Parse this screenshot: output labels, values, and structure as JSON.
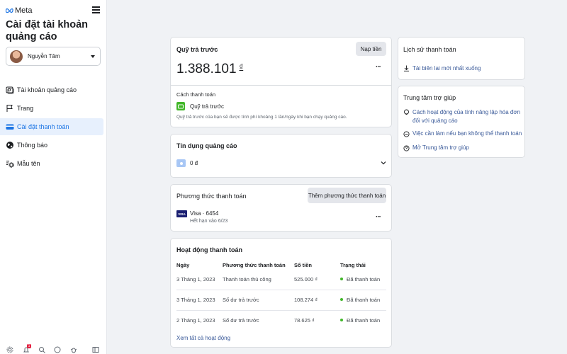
{
  "brand": {
    "name": "Meta"
  },
  "sidebar": {
    "title": "Cài đặt tài khoản quảng cáo",
    "account_name": "Nguyễn Tâm",
    "items": [
      {
        "label": "Tài khoản quảng cáo",
        "icon": "ad-accounts-icon"
      },
      {
        "label": "Trang",
        "icon": "flag-icon"
      },
      {
        "label": "Cài đặt thanh toán",
        "icon": "credit-card-icon",
        "active": true
      },
      {
        "label": "Thông báo",
        "icon": "globe-icon"
      },
      {
        "label": "Mẫu tên",
        "icon": "gear-list-icon"
      }
    ],
    "bottom": {
      "notification_count": "1"
    }
  },
  "prepaid": {
    "title": "Quỹ trả trước",
    "add_funds_label": "Nạp tiền",
    "balance": "1.388.101",
    "currency": "₫",
    "method_heading": "Cách thanh toán",
    "method_name": "Quỹ trả trước",
    "method_desc": "Quỹ trả trước của bạn sẽ được tính phí khoảng 1 lần/ngày khi bạn chạy quảng cáo."
  },
  "credit": {
    "title": "Tín dụng quảng cáo",
    "amount": "0 đ"
  },
  "payment_methods": {
    "title": "Phương thức thanh toán",
    "add_label": "Thêm phương thức thanh toán",
    "card_brand": "VISA",
    "card_name": "Visa · 6454",
    "card_expiry": "Hết hạn vào 6/23"
  },
  "activity": {
    "title": "Hoạt động thanh toán",
    "columns": [
      "Ngày",
      "Phương thức thanh toán",
      "Số tiền",
      "Trạng thái"
    ],
    "rows": [
      [
        "3 Tháng 1, 2023",
        "Thanh toán thủ công",
        "525.000 ₫",
        "Đã thanh toán"
      ],
      [
        "3 Tháng 1, 2023",
        "Số dư trả trước",
        "108.274 ₫",
        "Đã thanh toán"
      ],
      [
        "2 Tháng 1, 2023",
        "Số dư trả trước",
        "78.625 ₫",
        "Đã thanh toán"
      ]
    ],
    "view_all_label": "Xem tất cả hoạt động"
  },
  "history": {
    "title": "Lịch sử thanh toán",
    "download_label": "Tải biên lai mới nhất xuống"
  },
  "help": {
    "title": "Trung tâm trợ giúp",
    "links": [
      "Cách hoạt động của tính năng lập hóa đơn đối với quảng cáo",
      "Việc cần làm nếu bạn không thể thanh toán",
      "Mở Trung tâm trợ giúp"
    ]
  }
}
